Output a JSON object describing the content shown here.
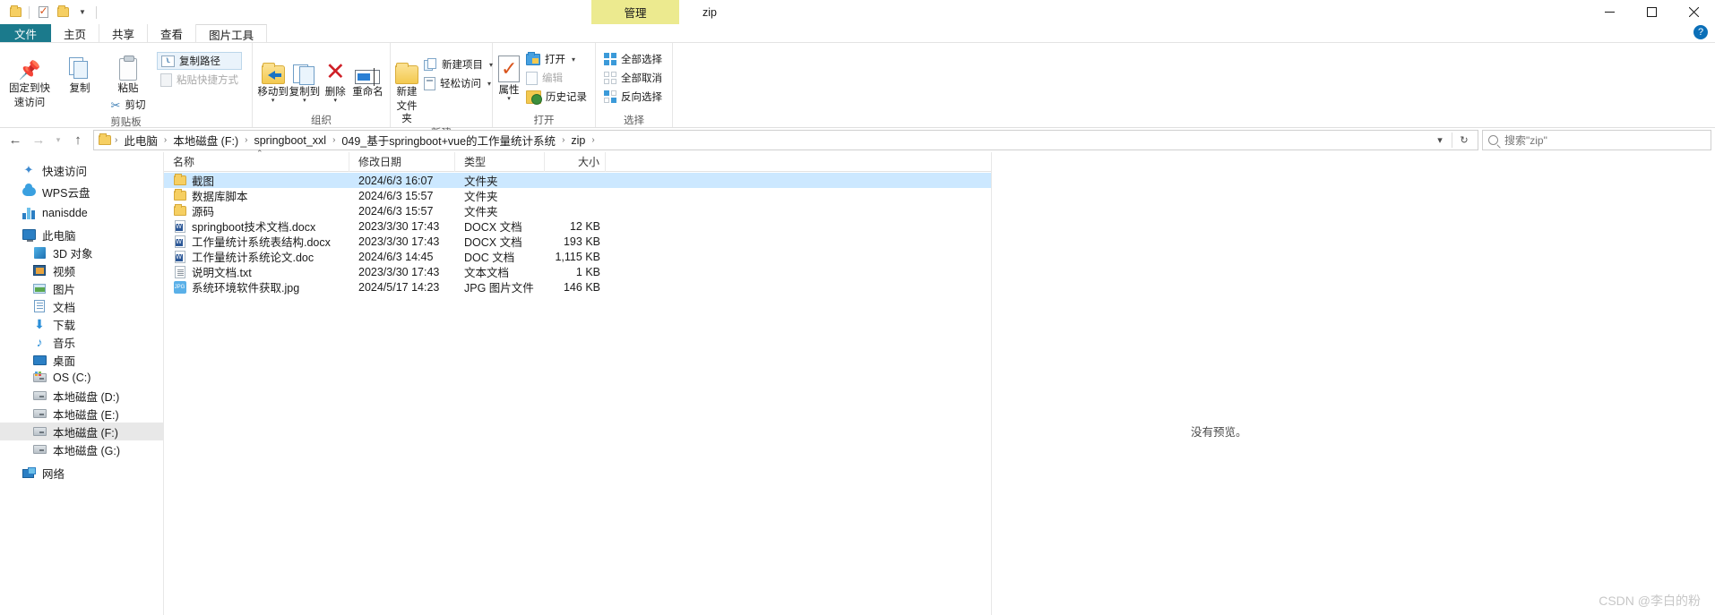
{
  "window": {
    "title": "zip",
    "manage_tab": "管理",
    "quick_access_icons": [
      "folder-icon",
      "properties-icon",
      "new-folder-icon",
      "customize-caret-icon"
    ],
    "controls": {
      "minimize": "minimize-icon",
      "maximize": "maximize-icon",
      "close": "close-icon"
    },
    "help": "?"
  },
  "ribbon_tabs": [
    {
      "label": "文件",
      "name": "tab-file",
      "active": false
    },
    {
      "label": "主页",
      "name": "tab-home",
      "active": true
    },
    {
      "label": "共享",
      "name": "tab-share",
      "active": false
    },
    {
      "label": "查看",
      "name": "tab-view",
      "active": false
    },
    {
      "label": "图片工具",
      "name": "tab-picture-tools",
      "active": false
    }
  ],
  "ribbon": {
    "groups": [
      {
        "label": "剪贴板",
        "name": "group-clipboard",
        "big": [
          {
            "label": "固定到快\n速访问",
            "line1": "固定到快",
            "line2": "速访问",
            "icon": "pin-icon"
          },
          {
            "label": "复制",
            "line1": "复制",
            "line2": "",
            "icon": "copy-icon"
          },
          {
            "label": "粘贴",
            "line1": "粘贴",
            "line2": "",
            "icon": "paste-icon"
          }
        ],
        "small": [
          {
            "label": "剪切",
            "icon": "scissors-icon",
            "dim": false
          },
          {
            "label": "复制路径",
            "icon": "copy-path-icon",
            "boxed": true
          },
          {
            "label": "粘贴快捷方式",
            "icon": "paste-shortcut-icon",
            "dim": true
          }
        ]
      },
      {
        "label": "组织",
        "name": "group-organize",
        "big": [
          {
            "label": "移动到",
            "icon": "move-to-icon",
            "caret": true
          },
          {
            "label": "复制到",
            "icon": "copy-to-icon",
            "caret": true
          },
          {
            "label": "删除",
            "icon": "delete-icon",
            "caret": true
          },
          {
            "label": "重命名",
            "icon": "rename-icon",
            "caret": false
          }
        ]
      },
      {
        "label": "新建",
        "name": "group-new",
        "big": [
          {
            "line1": "新建",
            "line2": "文件夹",
            "icon": "new-folder-icon"
          }
        ],
        "small": [
          {
            "label": "新建项目",
            "icon": "new-item-icon",
            "caret": true
          },
          {
            "label": "轻松访问",
            "icon": "easy-access-icon",
            "caret": true
          }
        ]
      },
      {
        "label": "打开",
        "name": "group-open",
        "big": [
          {
            "label": "属性",
            "icon": "properties-icon",
            "caret": true
          }
        ],
        "small": [
          {
            "label": "打开",
            "icon": "open-icon",
            "caret": true
          },
          {
            "label": "编辑",
            "icon": "edit-icon",
            "dim": true
          },
          {
            "label": "历史记录",
            "icon": "history-icon"
          }
        ]
      },
      {
        "label": "选择",
        "name": "group-select",
        "small": [
          {
            "label": "全部选择",
            "icon": "select-all-icon"
          },
          {
            "label": "全部取消",
            "icon": "select-none-icon"
          },
          {
            "label": "反向选择",
            "icon": "invert-selection-icon"
          }
        ]
      }
    ]
  },
  "address_bar": {
    "back": "back-arrow-icon",
    "forward": "forward-arrow-icon",
    "recent": "recent-locations-caret-icon",
    "up": "up-arrow-icon",
    "crumbs": [
      "此电脑",
      "本地磁盘 (F:)",
      "springboot_xxl",
      "049_基于springboot+vue的工作量统计系统",
      "zip"
    ],
    "separator": "›",
    "dropdown": "history-caret-icon",
    "refresh": "refresh-icon",
    "search_placeholder": "搜索\"zip\"",
    "search_value": ""
  },
  "sidebar": {
    "items": [
      {
        "label": "快速访问",
        "icon": "quick-access-star-icon",
        "indent": false,
        "selected": false
      },
      {
        "label": "WPS云盘",
        "icon": "cloud-icon",
        "indent": false,
        "selected": false
      },
      {
        "label": "nanisdde",
        "icon": "chart-icon",
        "indent": false,
        "selected": false
      },
      {
        "label": "此电脑",
        "icon": "this-pc-icon",
        "indent": false,
        "selected": false
      },
      {
        "label": "3D 对象",
        "icon": "3d-objects-icon",
        "indent": true,
        "selected": false
      },
      {
        "label": "视频",
        "icon": "videos-icon",
        "indent": true,
        "selected": false
      },
      {
        "label": "图片",
        "icon": "pictures-icon",
        "indent": true,
        "selected": false
      },
      {
        "label": "文档",
        "icon": "documents-icon",
        "indent": true,
        "selected": false
      },
      {
        "label": "下载",
        "icon": "downloads-icon",
        "indent": true,
        "selected": false
      },
      {
        "label": "音乐",
        "icon": "music-icon",
        "indent": true,
        "selected": false
      },
      {
        "label": "桌面",
        "icon": "desktop-icon",
        "indent": true,
        "selected": false
      },
      {
        "label": "OS (C:)",
        "icon": "os-drive-icon",
        "indent": true,
        "selected": false
      },
      {
        "label": "本地磁盘 (D:)",
        "icon": "drive-icon",
        "indent": true,
        "selected": false
      },
      {
        "label": "本地磁盘 (E:)",
        "icon": "drive-icon",
        "indent": true,
        "selected": false
      },
      {
        "label": "本地磁盘 (F:)",
        "icon": "drive-icon",
        "indent": true,
        "selected": true
      },
      {
        "label": "本地磁盘 (G:)",
        "icon": "drive-icon",
        "indent": true,
        "selected": false
      },
      {
        "label": "网络",
        "icon": "network-icon",
        "indent": false,
        "selected": false
      }
    ]
  },
  "file_list": {
    "columns": [
      {
        "label": "名称",
        "sorted": true
      },
      {
        "label": "修改日期",
        "sorted": false
      },
      {
        "label": "类型",
        "sorted": false
      },
      {
        "label": "大小",
        "sorted": false
      }
    ],
    "rows": [
      {
        "name": "截图",
        "date": "2024/6/3 16:07",
        "type": "文件夹",
        "size": "",
        "icon": "folder-icon",
        "selected": true
      },
      {
        "name": "数据库脚本",
        "date": "2024/6/3 15:57",
        "type": "文件夹",
        "size": "",
        "icon": "folder-icon",
        "selected": false
      },
      {
        "name": "源码",
        "date": "2024/6/3 15:57",
        "type": "文件夹",
        "size": "",
        "icon": "folder-icon",
        "selected": false
      },
      {
        "name": "springboot技术文档.docx",
        "date": "2023/3/30 17:43",
        "type": "DOCX 文档",
        "size": "12 KB",
        "icon": "word-doc-icon",
        "selected": false
      },
      {
        "name": "工作量统计系统表结构.docx",
        "date": "2023/3/30 17:43",
        "type": "DOCX 文档",
        "size": "193 KB",
        "icon": "word-doc-icon",
        "selected": false
      },
      {
        "name": "工作量统计系统论文.doc",
        "date": "2024/6/3 14:45",
        "type": "DOC 文档",
        "size": "1,115 KB",
        "icon": "word-doc-icon",
        "selected": false
      },
      {
        "name": "说明文档.txt",
        "date": "2023/3/30 17:43",
        "type": "文本文档",
        "size": "1 KB",
        "icon": "text-file-icon",
        "selected": false
      },
      {
        "name": "系统环境软件获取.jpg",
        "date": "2024/5/17 14:23",
        "type": "JPG 图片文件",
        "size": "146 KB",
        "icon": "jpg-image-icon",
        "selected": false
      }
    ]
  },
  "preview_pane": {
    "message": "没有预览。"
  },
  "watermark": "CSDN @李白的粉",
  "colors": {
    "file_tab": "#1b7a8c",
    "manage_badge": "#ecea8f",
    "selection": "#cce8ff",
    "sidebar_selection": "#e8e8e8",
    "folder_yellow": "#f6cf62",
    "accent_blue": "#2b7fc4",
    "delete_red": "#cf2027"
  }
}
